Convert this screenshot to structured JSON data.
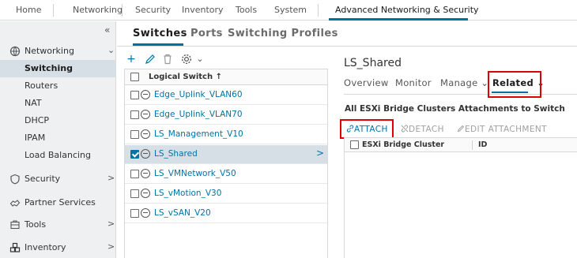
{
  "topnav": {
    "items": [
      "Home",
      "Networking",
      "Security",
      "Inventory",
      "Tools",
      "System",
      "Advanced Networking & Security"
    ]
  },
  "sidebar": {
    "collapse_glyph": "«",
    "items": [
      {
        "label": "Networking",
        "icon": "networking-icon",
        "expanded": true
      },
      {
        "label": "Switching",
        "selected": true
      },
      {
        "label": "Routers"
      },
      {
        "label": "NAT"
      },
      {
        "label": "DHCP"
      },
      {
        "label": "IPAM"
      },
      {
        "label": "Load Balancing"
      },
      {
        "label": "Security",
        "icon": "shield-icon"
      },
      {
        "label": "Partner Services",
        "icon": "partner-services-icon"
      },
      {
        "label": "Tools",
        "icon": "tools-icon"
      },
      {
        "label": "Inventory",
        "icon": "inventory-icon"
      }
    ]
  },
  "main_tabs": [
    "Switches",
    "Ports",
    "Switching Profiles"
  ],
  "switch_list": {
    "header": "Logical Switch ↑",
    "rows": [
      {
        "name": "Edge_Uplink_VLAN60"
      },
      {
        "name": "Edge_Uplink_VLAN70"
      },
      {
        "name": "LS_Management_V10"
      },
      {
        "name": "LS_Shared",
        "selected": true
      },
      {
        "name": "LS_VMNetwork_V50"
      },
      {
        "name": "LS_vMotion_V30"
      },
      {
        "name": "LS_vSAN_V20"
      }
    ]
  },
  "detail": {
    "title": "LS_Shared",
    "tabs": [
      "Overview",
      "Monitor",
      "Manage ⌄",
      "Related ⌄"
    ],
    "section_title": "All ESXi Bridge Clusters Attachments to Switch",
    "actions": [
      "ATTACH",
      "DETACH",
      "EDIT ATTACHMENT"
    ],
    "grid_columns": [
      "ESXi Bridge Cluster",
      "ID"
    ]
  },
  "colors": {
    "accent": "#0072a3",
    "highlight_box": "#e00000",
    "sidebar_bg": "#eef0f2",
    "selected_bg": "#d7dfe6"
  }
}
